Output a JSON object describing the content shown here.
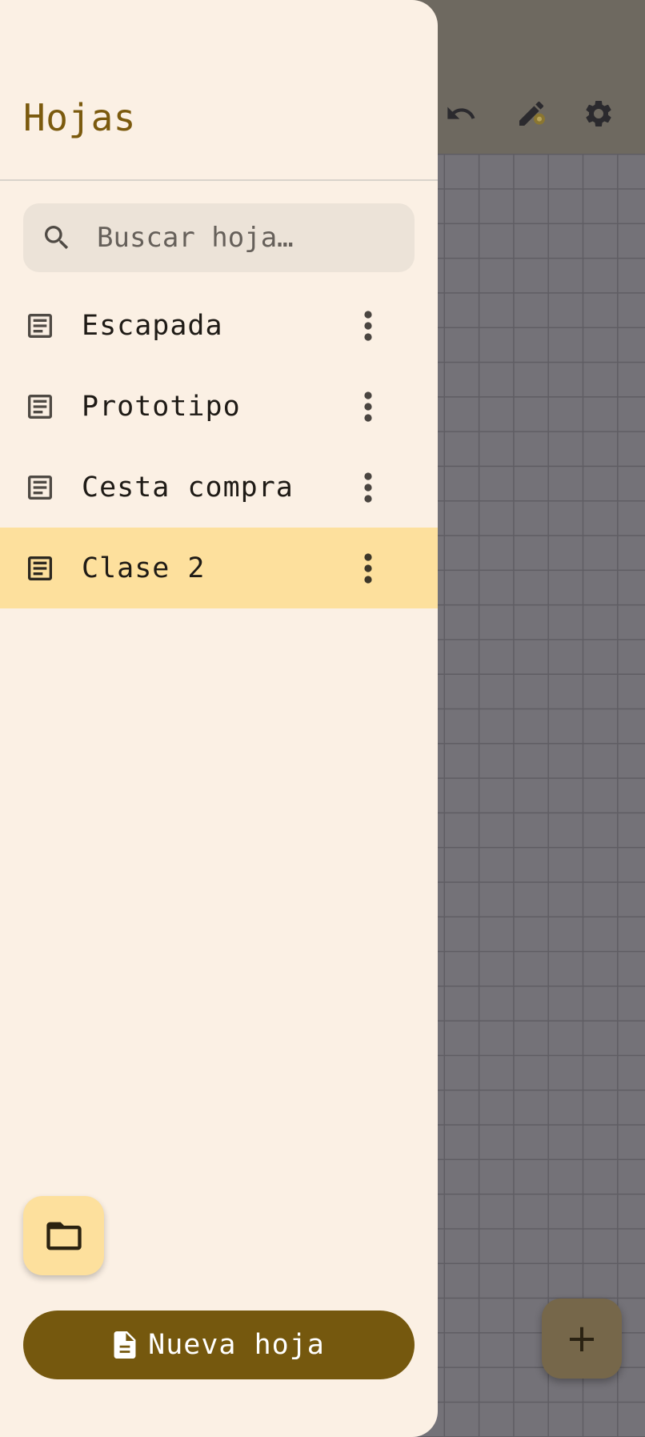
{
  "drawer": {
    "title": "Hojas",
    "search": {
      "placeholder": "Buscar hoja…",
      "icon": "search-icon"
    },
    "sheets": [
      {
        "label": "Escapada",
        "icon": "document-icon",
        "selected": false
      },
      {
        "label": "Prototipo",
        "icon": "document-icon",
        "selected": false
      },
      {
        "label": "Cesta compra",
        "icon": "document-icon",
        "selected": false
      },
      {
        "label": "Clase 2",
        "icon": "document-icon",
        "selected": true
      }
    ],
    "folder_button": {
      "icon": "folder-icon"
    },
    "new_sheet_button": {
      "label": "Nueva hoja",
      "icon": "file-icon"
    }
  },
  "toolbar": {
    "icons": [
      "undo-icon",
      "pen-icon",
      "settings-icon"
    ]
  },
  "fab": {
    "label": "+",
    "icon": "plus-icon"
  },
  "colors": {
    "drawer_bg": "#fbf0e4",
    "title": "#7b5a0e",
    "selected_row": "#fde09d",
    "primary_button": "#75580e",
    "scrim": "#6f6d72"
  }
}
